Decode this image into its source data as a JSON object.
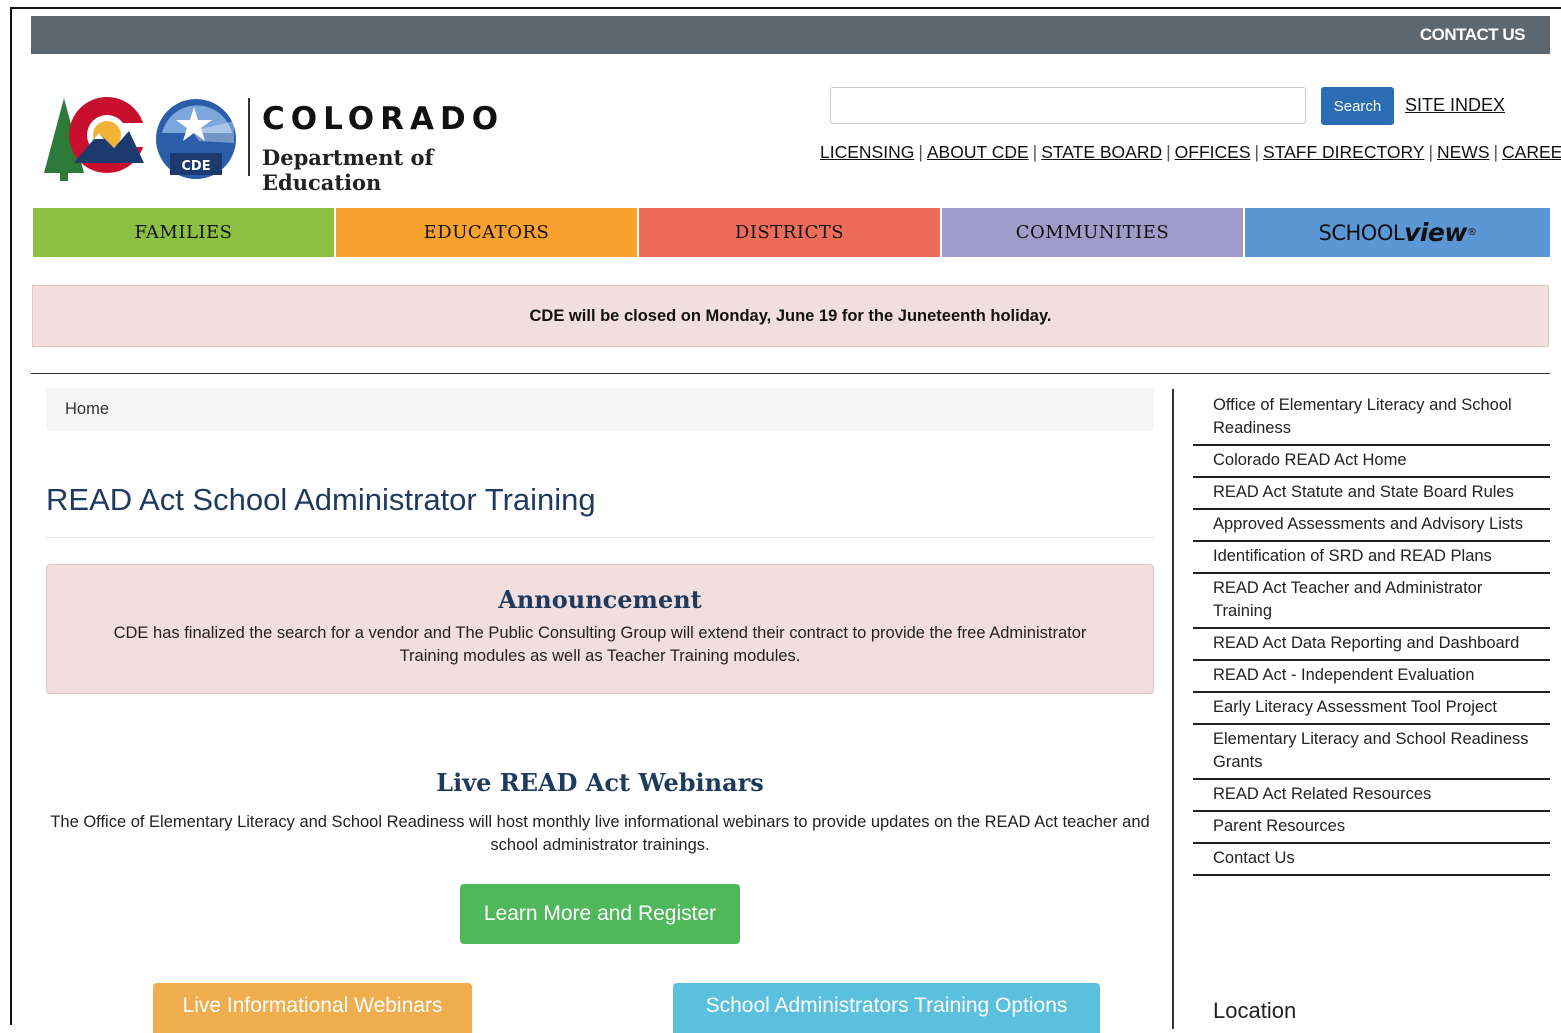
{
  "topbar": {
    "contact_us": "CONTACT US"
  },
  "logo": {
    "title": "COLORADO",
    "subtitle": "Department of Education",
    "seal_text": "CDE"
  },
  "search": {
    "placeholder": "",
    "button": "Search",
    "site_index": "SITE INDEX"
  },
  "util_links": [
    "LICENSING",
    "ABOUT CDE",
    "STATE BOARD",
    "OFFICES",
    "STAFF DIRECTORY",
    "NEWS",
    "CAREERS"
  ],
  "main_nav": [
    {
      "label": "FAMILIES",
      "color": "#8cc043"
    },
    {
      "label": "EDUCATORS",
      "color": "#f7a12e"
    },
    {
      "label": "DISTRICTS",
      "color": "#ee6d5a"
    },
    {
      "label": "COMMUNITIES",
      "color": "#a09bc8"
    },
    {
      "label_a": "SCHOOL",
      "label_b": "view",
      "label_c": "®",
      "color": "#5b97d5"
    }
  ],
  "alert": "CDE will be closed on Monday, June 19 for the Juneteenth holiday.",
  "breadcrumb": "Home",
  "page_title": "READ Act School Administrator Training",
  "announcement": {
    "heading": "Announcement",
    "text": "CDE has finalized the search for a vendor and The Public Consulting Group will extend their contract to provide the free Administrator Training modules as well as Teacher Training modules."
  },
  "webinars": {
    "heading": "Live READ Act Webinars",
    "text": "The Office of Elementary Literacy and School Readiness will host monthly live informational webinars to provide updates on the READ Act teacher and school administrator trainings.",
    "register_button": "Learn More and Register"
  },
  "buttons": {
    "live_webinars": "Live Informational Webinars",
    "admin_training": "School Administrators Training Options"
  },
  "sidebar": {
    "items": [
      "Office of Elementary Literacy and School Readiness",
      "Colorado READ Act Home",
      "READ Act Statute and State Board Rules",
      "Approved Assessments and Advisory Lists",
      "Identification of SRD and READ Plans",
      "READ Act Teacher and Administrator Training",
      "READ Act Data Reporting and Dashboard",
      "READ Act - Independent Evaluation",
      "Early Literacy Assessment Tool Project",
      "Elementary Literacy and School Readiness Grants",
      "READ Act Related Resources",
      "Parent Resources",
      "Contact Us"
    ],
    "location_heading": "Location"
  }
}
